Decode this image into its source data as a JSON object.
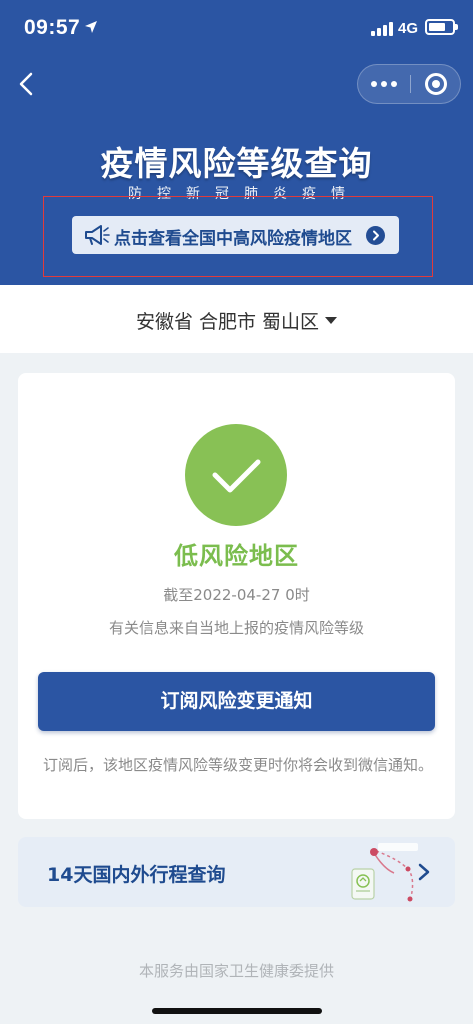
{
  "status_bar": {
    "time": "09:57",
    "network": "4G"
  },
  "header": {
    "title": "疫情风险等级查询",
    "subtitle": "防控新冠肺炎疫情",
    "notice_button_label": "点击查看全国中高风险疫情地区"
  },
  "location": {
    "label": "安徽省 合肥市 蜀山区"
  },
  "risk_card": {
    "level": "低风险地区",
    "as_of": "截至2022-04-27 0时",
    "source_note": "有关信息来自当地上报的疫情风险等级",
    "subscribe_button_label": "订阅风险变更通知",
    "subscribe_note": "订阅后，该地区疫情风险等级变更时你将会收到微信通知。"
  },
  "trip_card": {
    "label": "14天国内外行程查询"
  },
  "footer": {
    "text": "本服务由国家卫生健康委提供"
  },
  "colors": {
    "header_blue": "#2b55a3",
    "low_risk_green": "#88c155",
    "outline_red": "#e03b3b"
  }
}
